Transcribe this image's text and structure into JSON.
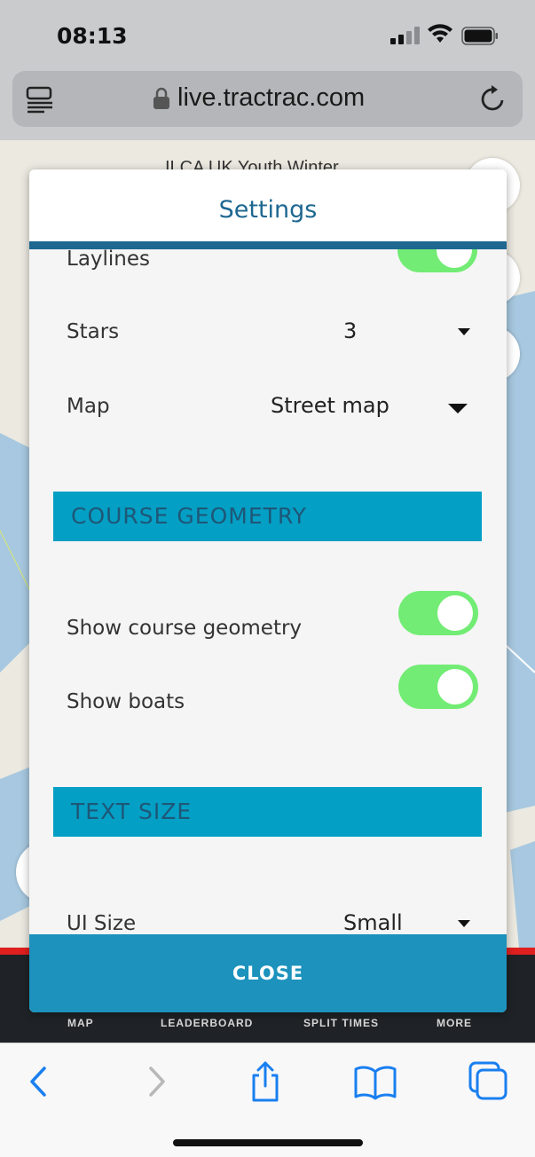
{
  "status_bar": {
    "time": "08:13"
  },
  "browser": {
    "url": "live.tractrac.com"
  },
  "map": {
    "event_title": "ILCA UK Youth Winter"
  },
  "settings": {
    "title": "Settings",
    "laylines_label": "Laylines",
    "stars": {
      "label": "Stars",
      "value": "3"
    },
    "map": {
      "label": "Map",
      "value": "Street map"
    },
    "course_geometry": {
      "heading": "COURSE GEOMETRY",
      "show_course_geometry": {
        "label": "Show course geometry",
        "on": true
      },
      "show_boats": {
        "label": "Show boats",
        "on": true
      }
    },
    "text_size": {
      "heading": "TEXT SIZE",
      "ui_size": {
        "label": "UI Size",
        "value": "Small"
      }
    },
    "close_label": "CLOSE"
  },
  "app_nav": {
    "items": [
      "MAP",
      "LEADERBOARD",
      "SPLIT TIMES",
      "MORE"
    ]
  },
  "colors": {
    "header_accent": "#1e6791",
    "section_bar": "#049fc5",
    "toggle_on": "#72ec74",
    "close_button": "#1c92bd",
    "safari_blue": "#1a7ff0"
  }
}
